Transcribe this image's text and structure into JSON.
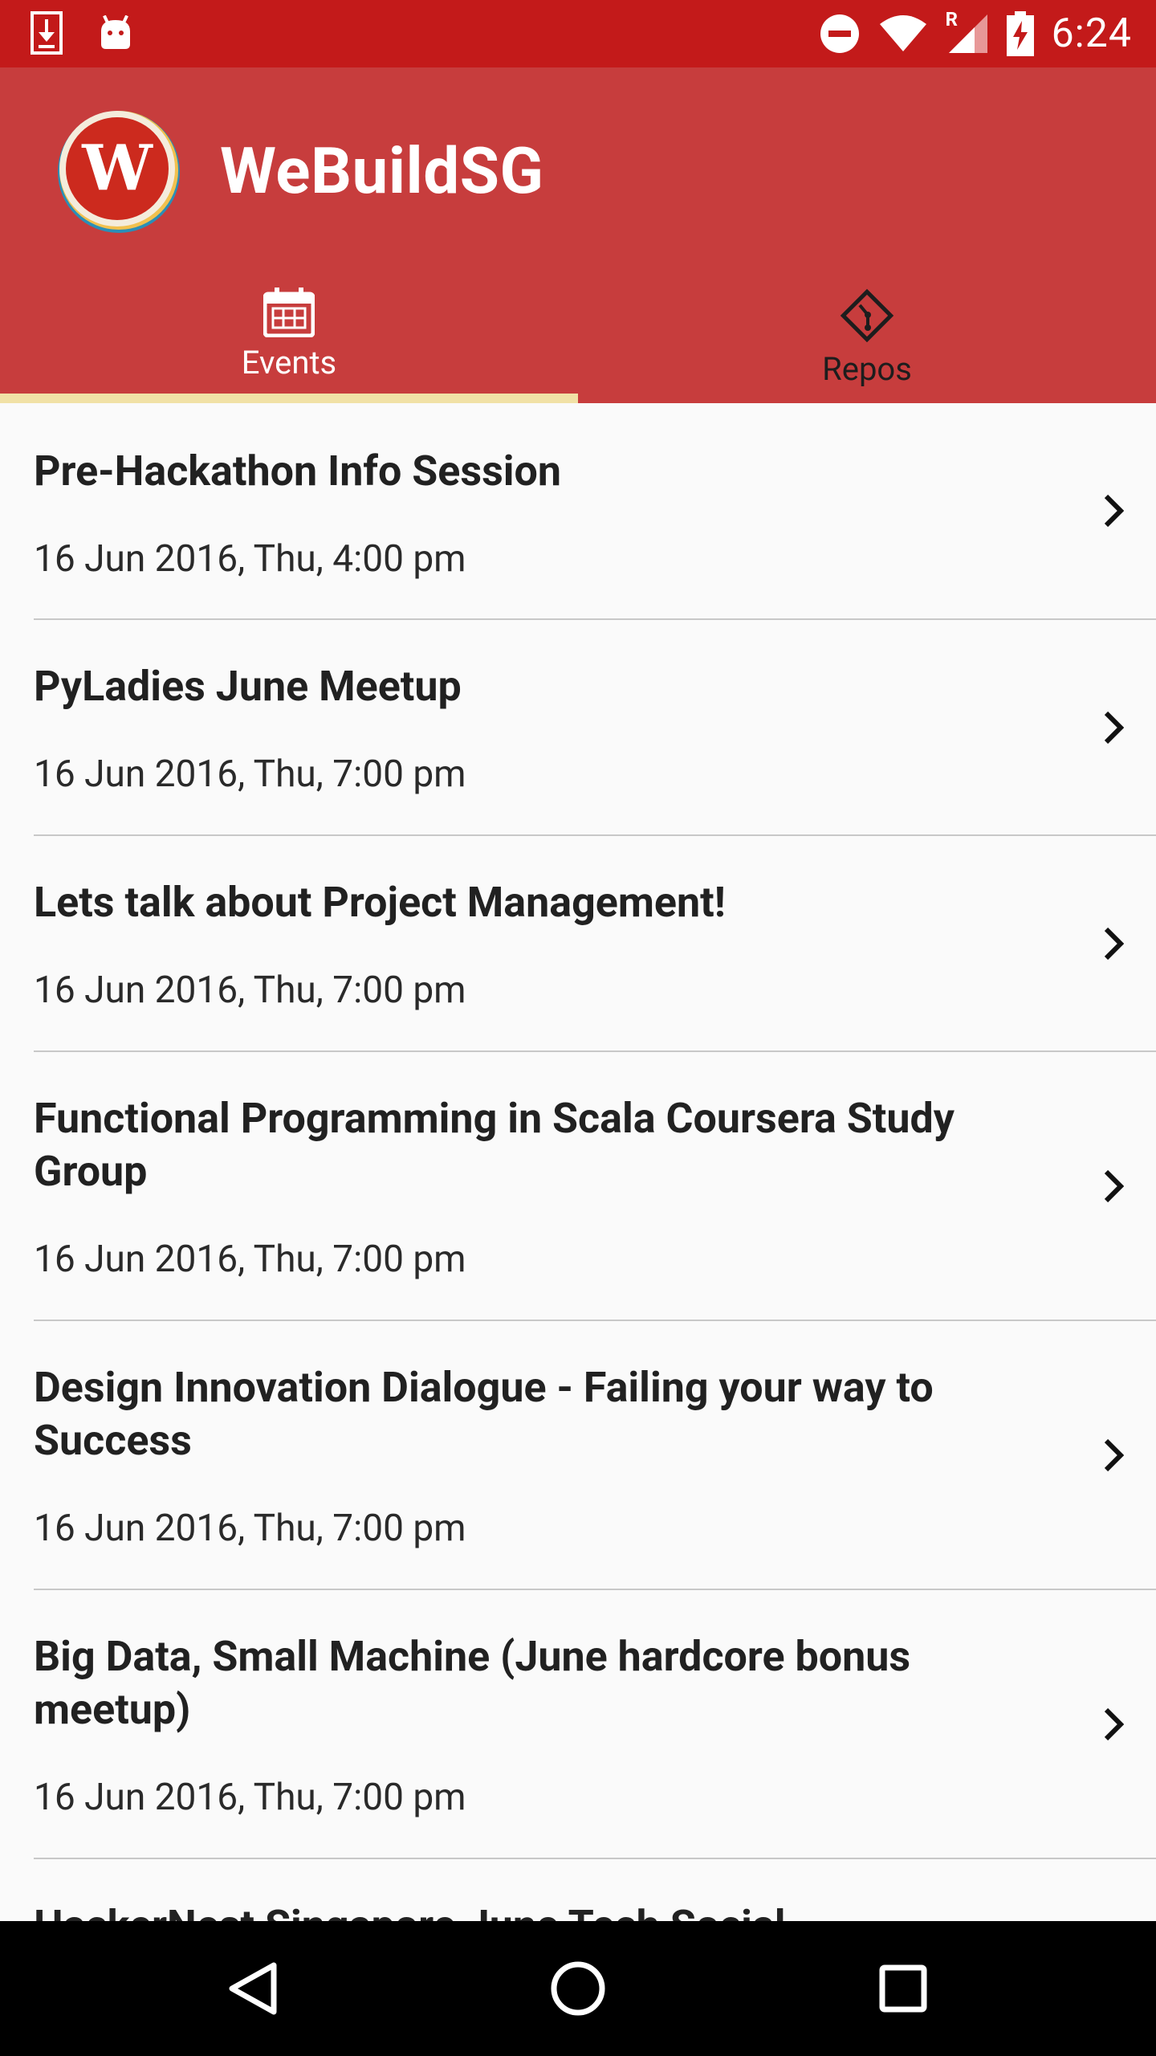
{
  "status_bar": {
    "time": "6:24",
    "icons": [
      "download-icon",
      "android-icon",
      "do-not-disturb-icon",
      "wifi-icon",
      "signal-icon",
      "battery-charging-icon"
    ],
    "signal_roaming_label": "R"
  },
  "app": {
    "title": "WeBuildSG",
    "logo_letter": "W"
  },
  "tabs": [
    {
      "label": "Events",
      "icon": "calendar-icon",
      "active": true
    },
    {
      "label": "Repos",
      "icon": "git-icon",
      "active": false
    }
  ],
  "colors": {
    "status_bar": "#c31a1a",
    "app_bar": "#c73d3d",
    "tab_indicator": "#f1e1a6"
  },
  "events": [
    {
      "title": "Pre-Hackathon Info Session",
      "date": "16 Jun 2016, Thu, 4:00 pm"
    },
    {
      "title": "PyLadies June Meetup",
      "date": "16 Jun 2016, Thu, 7:00 pm"
    },
    {
      "title": "Lets talk about Project Management!",
      "date": "16 Jun 2016, Thu, 7:00 pm"
    },
    {
      "title": "Functional Programming in Scala Coursera Study Group",
      "date": "16 Jun 2016, Thu, 7:00 pm"
    },
    {
      "title": "Design Innovation Dialogue - Failing your way to Success",
      "date": "16 Jun 2016, Thu, 7:00 pm"
    },
    {
      "title": "Big Data, Small Machine (June hardcore bonus meetup)",
      "date": "16 Jun 2016, Thu, 7:00 pm"
    },
    {
      "title": "HackerNest Singapore June Tech Social",
      "date": ""
    }
  ],
  "nav_bar": [
    "back-icon",
    "home-icon",
    "recents-icon"
  ]
}
